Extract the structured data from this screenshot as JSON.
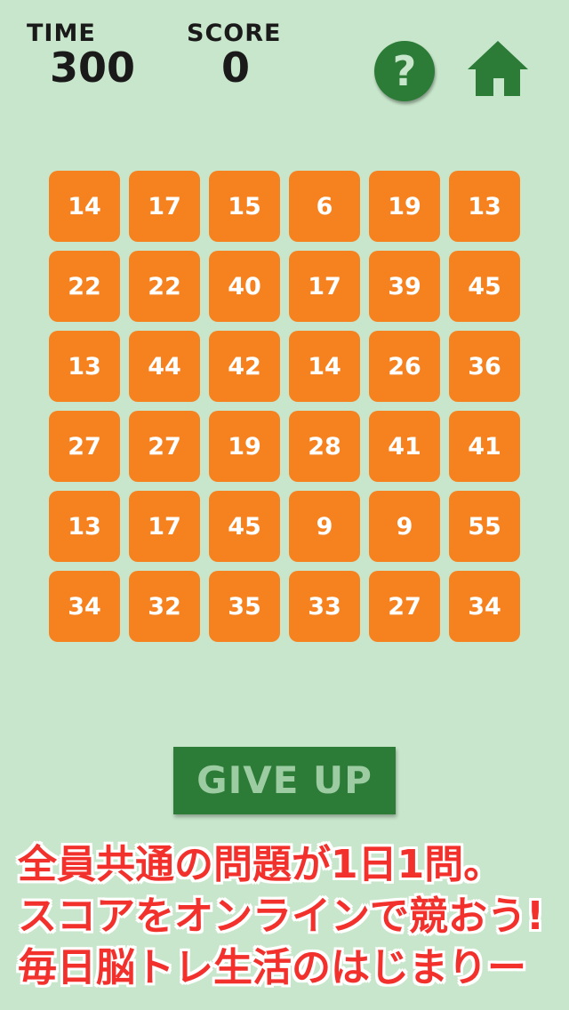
{
  "header": {
    "time_label": "TIME",
    "time_value": "300",
    "score_label": "SCORE",
    "score_value": "0",
    "help_symbol": "?"
  },
  "icons": {
    "help": "question-mark-icon",
    "home": "home-icon"
  },
  "grid": [
    "14",
    "17",
    "15",
    "6",
    "19",
    "13",
    "22",
    "22",
    "40",
    "17",
    "39",
    "45",
    "13",
    "44",
    "42",
    "14",
    "26",
    "36",
    "27",
    "27",
    "19",
    "28",
    "41",
    "41",
    "13",
    "17",
    "45",
    "9",
    "9",
    "55",
    "34",
    "32",
    "35",
    "33",
    "27",
    "34"
  ],
  "give_up_label": "GIVE UP",
  "promo_lines": [
    "全員共通の問題が1日1問。",
    "スコアをオンラインで競おう!",
    "毎日脳トレ生活のはじまりー"
  ],
  "colors": {
    "background": "#c8e6cb",
    "tile": "#f5821f",
    "button": "#2c7b37",
    "promo_text": "#f2312c"
  }
}
